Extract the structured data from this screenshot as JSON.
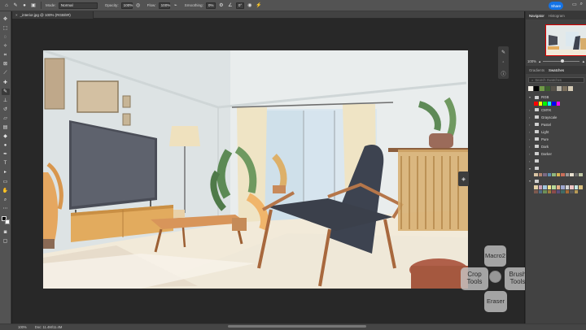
{
  "options_bar": {
    "mode_label": "Mode:",
    "mode_value": "Normal",
    "opacity_label": "Opacity:",
    "opacity_value": "100%",
    "flow_label": "Flow:",
    "flow_value": "100%",
    "smoothing_label": "Smoothing:",
    "smoothing_value": "0%",
    "angle_value": "0°",
    "share_label": "Share"
  },
  "document": {
    "tab_title": "_interior.jpg @ 100% (RGB/8#)",
    "close_glyph": "×"
  },
  "radial_menu": {
    "top": "Macro2",
    "left": "Crop\nTools",
    "right": "Brush\nTools",
    "bottom": "Eraser"
  },
  "status_bar": {
    "zoom": "100%",
    "doc_info": "Doc: 11.4M/11.4M"
  },
  "navigator": {
    "tab_navigator": "Navigator",
    "tab_histogram": "Histogram",
    "zoom_value": "100%"
  },
  "swatches_panel": {
    "tab_gradients": "Gradients",
    "tab_swatches": "Swatches",
    "search_placeholder": "Search Swatches",
    "groups": [
      {
        "name": "RGB"
      },
      {
        "name": "CMYK"
      },
      {
        "name": "Grayscale"
      },
      {
        "name": "Pastel"
      },
      {
        "name": "Light"
      },
      {
        "name": "Pure"
      },
      {
        "name": "Dark"
      },
      {
        "name": "Darker"
      }
    ]
  },
  "colors": {
    "accent": "#1473e6",
    "panel_bg": "#424242",
    "chrome": "#535353"
  }
}
